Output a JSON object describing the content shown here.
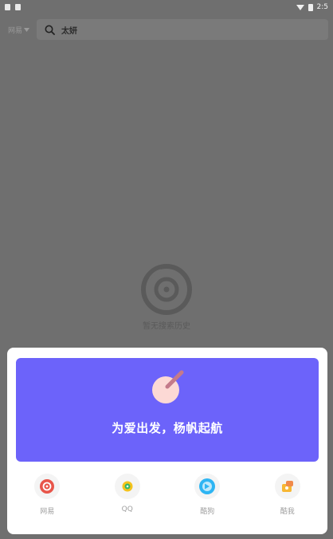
{
  "status_bar": {
    "time": "2:5"
  },
  "search": {
    "source_label": "网易",
    "query": "太妍"
  },
  "empty_state": {
    "text": "暂无搜索历史"
  },
  "banner": {
    "text": "为爱出发，杨帆起航"
  },
  "options": [
    {
      "label": "网易",
      "icon": "netease-music-icon",
      "color": "#e8554a"
    },
    {
      "label": "QQ",
      "icon": "qq-music-icon",
      "color": "#f4c31c"
    },
    {
      "label": "酷狗",
      "icon": "kugou-icon",
      "color": "#2eb5f3"
    },
    {
      "label": "酷我",
      "icon": "kuwo-icon",
      "color": "#f7b733"
    }
  ],
  "colors": {
    "overlay": "#6f6f6f",
    "banner": "#6c63fa",
    "sheet": "#ffffff"
  }
}
